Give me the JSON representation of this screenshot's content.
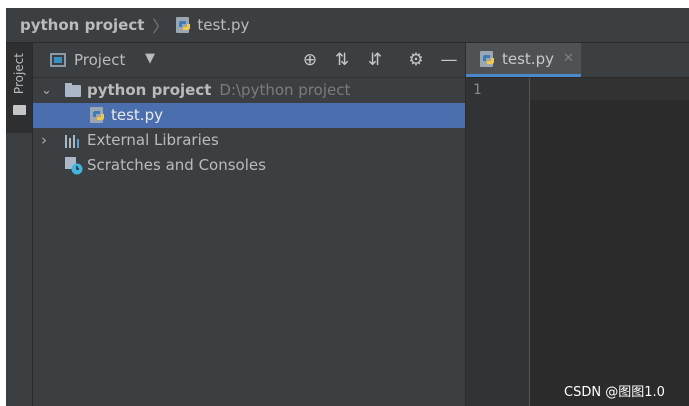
{
  "breadcrumb": {
    "project": "python project",
    "separator": "〉",
    "file": "test.py"
  },
  "left_strip": {
    "label": "Project"
  },
  "project_panel": {
    "title": "Project",
    "dropdown_glyph": "▼",
    "toolbar": {
      "locate": "⊕",
      "expand": "⇅",
      "collapse": "⇵",
      "settings": "⚙",
      "hide": "—"
    }
  },
  "tree": {
    "root": {
      "arrow": "⌄",
      "name": "python project",
      "path": "D:\\python project"
    },
    "file": {
      "name": "test.py",
      "selected": true
    },
    "libs": {
      "arrow": "›",
      "name": "External Libraries"
    },
    "scratches": {
      "name": "Scratches and Consoles"
    }
  },
  "editor": {
    "tab": {
      "label": "test.py",
      "close": "✕"
    },
    "line_numbers": [
      "1"
    ]
  },
  "watermark": "CSDN @图图1.0",
  "colors": {
    "selection": "#4b6eaf",
    "panel": "#3c3f41",
    "editor": "#2b2b2b",
    "tab_accent": "#4a88c7"
  },
  "icons": [
    "python-file-icon",
    "folder-icon",
    "libraries-icon",
    "scratches-icon",
    "locate-icon",
    "expand-all-icon",
    "collapse-all-icon",
    "gear-icon",
    "hide-icon",
    "close-icon"
  ]
}
